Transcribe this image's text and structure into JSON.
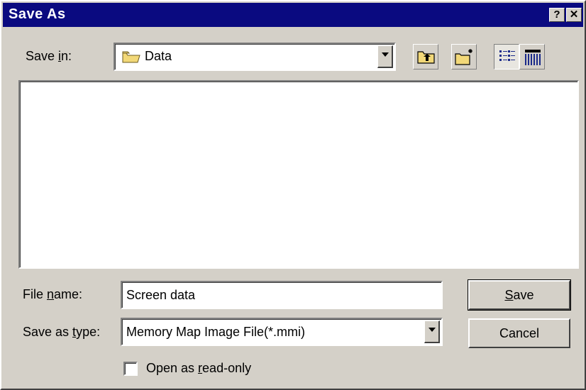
{
  "window": {
    "title": "Save As",
    "help_label": "?",
    "close_label": "✕"
  },
  "save_in": {
    "label_prefix": "Save ",
    "label_underlined": "i",
    "label_suffix": "n:",
    "value": "Data"
  },
  "toolbar": {
    "icons": [
      "up-one-level-icon",
      "create-new-folder-icon",
      "list-view-icon",
      "details-view-icon"
    ]
  },
  "file_list": {
    "items": []
  },
  "file_name": {
    "label_prefix": "File ",
    "label_underlined": "n",
    "label_suffix": "ame:",
    "value": "Screen data"
  },
  "save_as_type": {
    "label_prefix": "Save as ",
    "label_underlined": "t",
    "label_suffix": "ype:",
    "value": "Memory Map Image File(*.mmi)"
  },
  "buttons": {
    "save_underlined": "S",
    "save_rest": "ave",
    "cancel": "Cancel"
  },
  "read_only": {
    "label_prefix": "Open as ",
    "label_underlined": "r",
    "label_suffix": "ead-only",
    "checked": false
  },
  "colors": {
    "titlebar": "#0a0a80",
    "face": "#d4d0c8",
    "folder": "#f2d878"
  }
}
